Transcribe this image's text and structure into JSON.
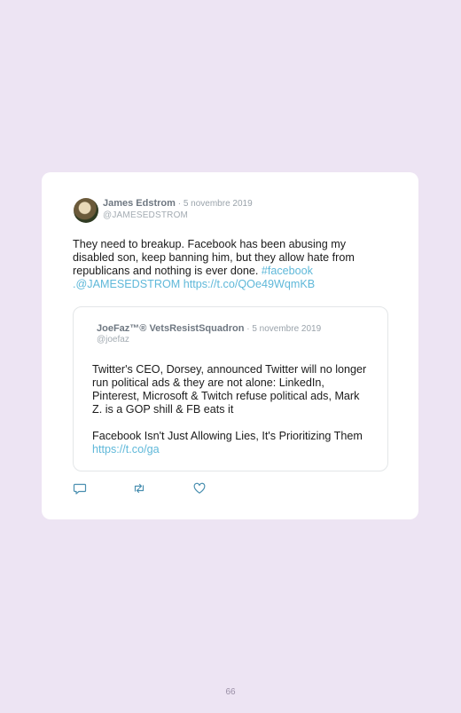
{
  "tweet": {
    "author_name": "James Edstrom",
    "separator": " · ",
    "date": "5 novembre 2019",
    "handle": "@JAMESEDSTROM",
    "text": "They need to breakup. Facebook has been abusing my disabled son, keep banning him, but they allow hate from republicans and nothing is ever done. ",
    "hashtag": "#facebook",
    "mention": ".@JAMESEDSTROM",
    "url": "https://t.co/QOe49WqmKB"
  },
  "quoted": {
    "author_name": "JoeFaz™® VetsResistSquadron",
    "separator": " · ",
    "date": "5 novembre 2019",
    "handle": "@joefaz",
    "paragraph1": "Twitter's CEO, Dorsey, announced Twitter will no longer run political ads & they are not alone: LinkedIn, Pinterest, Microsoft & Twitch refuse political ads, Mark Z. is a GOP shill & FB eats it",
    "paragraph2": "Facebook Isn't Just Allowing Lies, It's Prioritizing Them ",
    "url": "https://t.co/ga"
  },
  "actions": {
    "reply_icon": "reply-icon",
    "retweet_icon": "retweet-icon",
    "like_icon": "heart-icon"
  },
  "page_number": "66",
  "colors": {
    "background": "#ede4f3",
    "card": "#ffffff",
    "link": "#5fb8d9"
  }
}
